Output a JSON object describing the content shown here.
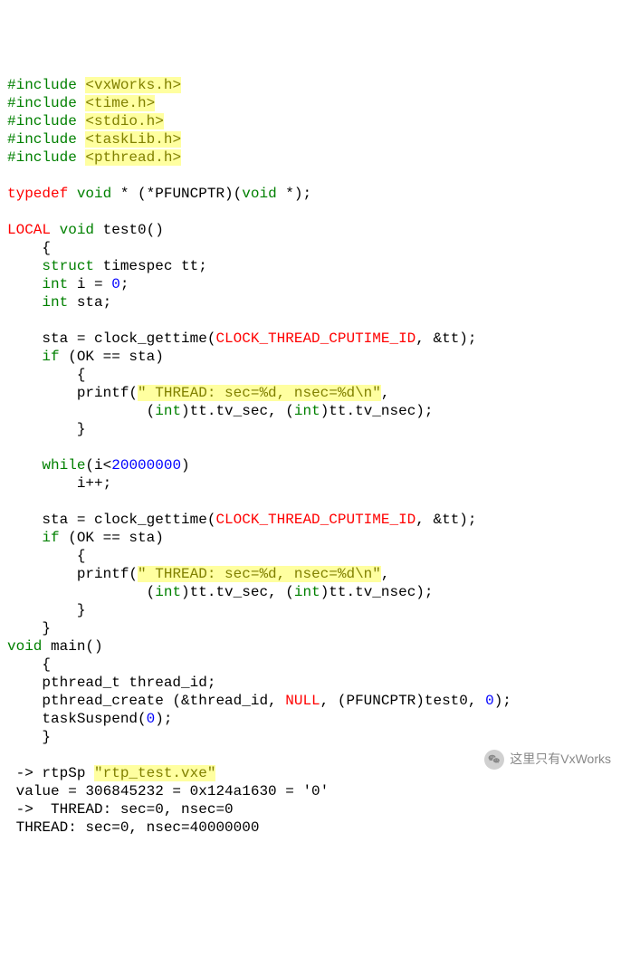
{
  "inc": {
    "pre": "#include ",
    "h1": "<vxWorks.h>",
    "h2": "<time.h>",
    "h3": "<stdio.h>",
    "h4": "<taskLib.h>",
    "h5": "<pthread.h>"
  },
  "td": {
    "typedef": "typedef",
    "void": "void",
    "star": " * (*PFUNCPTR)(",
    "void2": "void",
    "end": " *);"
  },
  "t0": {
    "local": "LOCAL",
    "void": "void",
    "name": " test0()",
    "open": "    {",
    "struct": "struct",
    "timespec": " timespec tt;",
    "int": "int",
    "ieq": " i = ",
    "zero": "0",
    "semi": ";",
    "int2": "int",
    "sta": " sta;",
    "call1a": "    sta = clock_gettime(",
    "clkid": "CLOCK_THREAD_CPUTIME_ID",
    "call1b": ", &tt);",
    "if": "if",
    "ifc": " (OK == sta)",
    "ob": "        {",
    "printf": "        printf(",
    "fmt": "\" THREAD: sec=%d, nsec=%d\\n\"",
    "comma": ",",
    "argline": "                (",
    "intc": "int",
    "arg1": ")tt.tv_sec, (",
    "intc2": "int",
    "arg2": ")tt.tv_nsec);",
    "cb": "        }",
    "while": "while",
    "wcond": "(i<",
    "wnum": "20000000",
    "wcond2": ")",
    "ipp": "        i++;",
    "close": "    }"
  },
  "main": {
    "void": "void",
    "name": " main()",
    "open": "    {",
    "pt": "    pthread_t thread_id;",
    "pcreate": "    pthread_create (&thread_id, ",
    "null": "NULL",
    "pc2": ", (PFUNCPTR)test0, ",
    "zero": "0",
    "pc3": ");",
    "susp": "    taskSuspend(",
    "zero2": "0",
    "susp2": ");",
    "close": "    }"
  },
  "out": {
    "l1a": " -> rtpSp ",
    "l1b": "\"rtp_test.vxe\"",
    "l2": " value = 306845232 = 0x124a1630 = '0'",
    "l3": " ->  THREAD: sec=0, nsec=0",
    "l4": " THREAD: sec=0, nsec=40000000"
  },
  "watermark": "这里只有VxWorks"
}
